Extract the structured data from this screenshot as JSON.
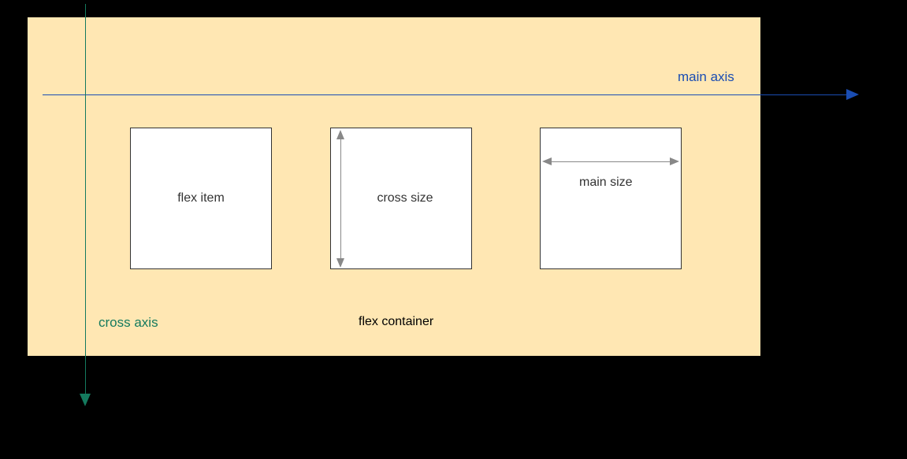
{
  "diagram": {
    "container_label": "flex container",
    "items": {
      "item1": "flex item",
      "item2": "cross size",
      "item3": "main size"
    },
    "axes": {
      "main": "main axis",
      "cross": "cross axis"
    }
  }
}
